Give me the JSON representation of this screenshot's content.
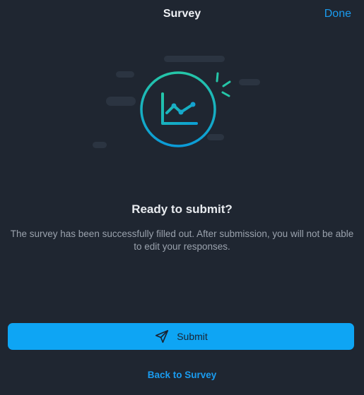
{
  "header": {
    "title": "Survey",
    "done_label": "Done"
  },
  "illustration": {
    "icon": "line-chart-icon",
    "ring_gradient": [
      "#25c6a8",
      "#0b9bd8"
    ]
  },
  "content": {
    "heading": "Ready to submit?",
    "description": "The survey has been successfully filled out. After submission, you will not be able to edit your responses."
  },
  "actions": {
    "submit_label": "Submit",
    "submit_icon": "send-icon",
    "back_label": "Back to Survey"
  },
  "colors": {
    "background": "#1f2631",
    "accent": "#0ea5f4",
    "link": "#1a9cf0"
  }
}
